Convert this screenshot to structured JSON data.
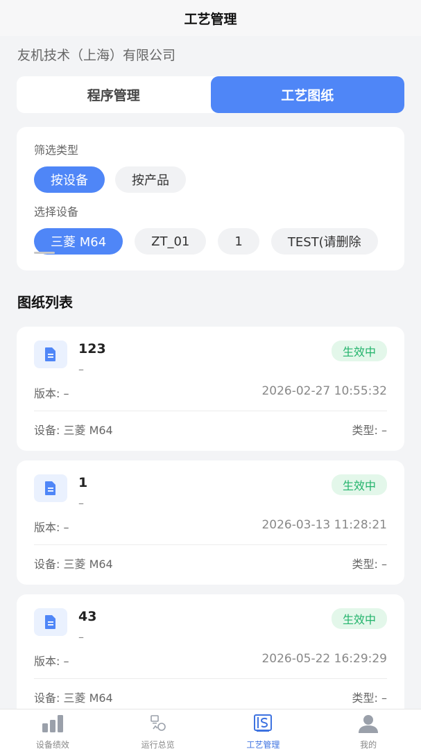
{
  "header": {
    "title": "工艺管理"
  },
  "company": "友机技术（上海）有限公司",
  "tabs": [
    {
      "label": "程序管理",
      "active": false
    },
    {
      "label": "工艺图纸",
      "active": true
    }
  ],
  "filter": {
    "type_label": "筛选类型",
    "types": [
      {
        "label": "按设备",
        "active": true
      },
      {
        "label": "按产品",
        "active": false
      }
    ],
    "device_label": "选择设备",
    "devices": [
      {
        "label": "三菱 M64",
        "active": true
      },
      {
        "label": "ZT_01",
        "active": false
      },
      {
        "label": "1",
        "active": false
      },
      {
        "label": "TEST(请删除",
        "active": false
      }
    ]
  },
  "list_title": "图纸列表",
  "drawings": [
    {
      "name": "123",
      "sub": "–",
      "status": "生效中",
      "version": "版本: –",
      "time": "2026-02-27 10:55:32",
      "device": "设备: 三菱 M64",
      "type": "类型: –"
    },
    {
      "name": "1",
      "sub": "–",
      "status": "生效中",
      "version": "版本: –",
      "time": "2026-03-13 11:28:21",
      "device": "设备: 三菱 M64",
      "type": "类型: –"
    },
    {
      "name": "43",
      "sub": "–",
      "status": "生效中",
      "version": "版本: –",
      "time": "2026-05-22 16:29:29",
      "device": "设备: 三菱 M64",
      "type": "类型: –"
    }
  ],
  "tabbar": [
    {
      "label": "设备绩效",
      "icon": "bar-chart-icon",
      "active": false
    },
    {
      "label": "运行总览",
      "icon": "overview-icon",
      "active": false
    },
    {
      "label": "工艺管理",
      "icon": "process-icon",
      "active": true
    },
    {
      "label": "我的",
      "icon": "user-icon",
      "active": false
    }
  ],
  "colors": {
    "primary": "#4f86f7",
    "status_green": "#22b36b",
    "status_bg": "#e3f7ea"
  }
}
